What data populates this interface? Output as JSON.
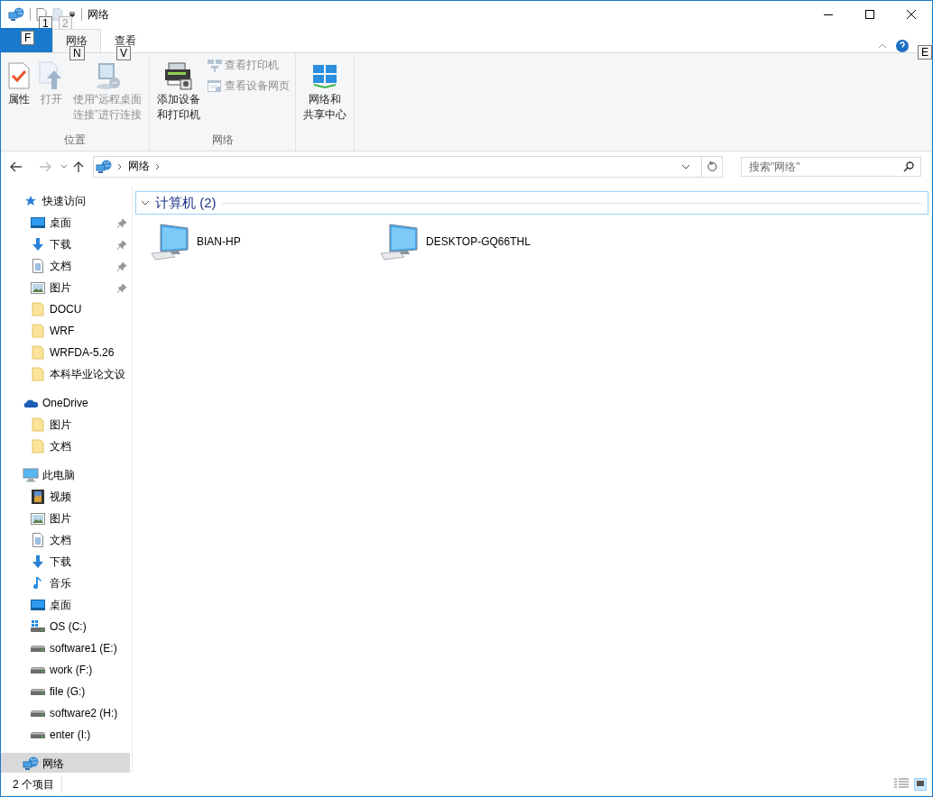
{
  "title_bar": {
    "title": "网络",
    "quick_access_keytips": [
      "1",
      "2"
    ]
  },
  "ribbon_tabs": [
    {
      "kind": "file",
      "keytip": "F",
      "selected": false
    },
    {
      "label": "网络",
      "kind": "tab",
      "keytip": "N",
      "selected": true
    },
    {
      "label": "查看",
      "kind": "tab",
      "keytip": "V",
      "selected": false
    }
  ],
  "help_keytip": "E",
  "ribbon_groups": [
    {
      "label": "位置",
      "buttons": [
        {
          "label": "属性",
          "kind": "large",
          "disabled": false
        },
        {
          "label": "打开",
          "kind": "large",
          "disabled": true
        },
        {
          "label": "使用“远程桌面连接”进行连接",
          "kind": "large",
          "disabled": true
        }
      ]
    },
    {
      "label": "网络",
      "buttons": [
        {
          "label": "添加设备和打印机",
          "kind": "large",
          "disabled": false
        },
        {
          "label": "查看打印机",
          "kind": "small",
          "disabled": true
        },
        {
          "label": "查看设备网页",
          "kind": "small",
          "disabled": true
        }
      ]
    },
    {
      "buttons": [
        {
          "label": "网络和共享中心",
          "kind": "large",
          "disabled": false
        }
      ]
    }
  ],
  "address_bar": {
    "crumbs": [
      "网络"
    ]
  },
  "search": {
    "placeholder": "搜索\"网络\""
  },
  "sidebar": {
    "sections": [
      {
        "label": "快速访问",
        "kind": "quick",
        "selected": false,
        "children": [
          {
            "label": "桌面",
            "kind": "desktop",
            "pinned": true
          },
          {
            "label": "下载",
            "kind": "download",
            "pinned": true
          },
          {
            "label": "文档",
            "kind": "document",
            "pinned": true
          },
          {
            "label": "图片",
            "kind": "pictures",
            "pinned": true
          },
          {
            "label": "DOCU",
            "kind": "folder",
            "pinned": false
          },
          {
            "label": "WRF",
            "kind": "folder",
            "pinned": false
          },
          {
            "label": "WRFDA-5.26",
            "kind": "folder",
            "pinned": false
          },
          {
            "label": "本科毕业论文设",
            "kind": "folder",
            "pinned": false
          }
        ]
      },
      {
        "label": "OneDrive",
        "kind": "onedrive",
        "selected": false,
        "children": [
          {
            "label": "图片",
            "kind": "folder",
            "pinned": false
          },
          {
            "label": "文档",
            "kind": "folder",
            "pinned": false
          }
        ]
      },
      {
        "label": "此电脑",
        "kind": "pc",
        "selected": false,
        "children": [
          {
            "label": "视频",
            "kind": "video",
            "pinned": false
          },
          {
            "label": "图片",
            "kind": "pictures",
            "pinned": false
          },
          {
            "label": "文档",
            "kind": "document",
            "pinned": false
          },
          {
            "label": "下载",
            "kind": "download",
            "pinned": false
          },
          {
            "label": "音乐",
            "kind": "music",
            "pinned": false
          },
          {
            "label": "桌面",
            "kind": "desktop",
            "pinned": false
          },
          {
            "label": "OS (C:)",
            "kind": "os-drive",
            "pinned": false
          },
          {
            "label": "software1 (E:)",
            "kind": "drive",
            "pinned": false
          },
          {
            "label": "work (F:)",
            "kind": "drive",
            "pinned": false
          },
          {
            "label": "file (G:)",
            "kind": "drive",
            "pinned": false
          },
          {
            "label": "software2 (H:)",
            "kind": "drive",
            "pinned": false
          },
          {
            "label": "enter (I:)",
            "kind": "drive",
            "pinned": false
          }
        ]
      },
      {
        "label": "网络",
        "kind": "network",
        "selected": true
      }
    ]
  },
  "content": {
    "groups": [
      {
        "title": "计算机 (2)",
        "expanded": true,
        "items": [
          {
            "name": "BIAN-HP"
          },
          {
            "name": "DESKTOP-GQ66THL"
          }
        ]
      }
    ]
  },
  "status_bar": {
    "count": "2 个项目"
  }
}
